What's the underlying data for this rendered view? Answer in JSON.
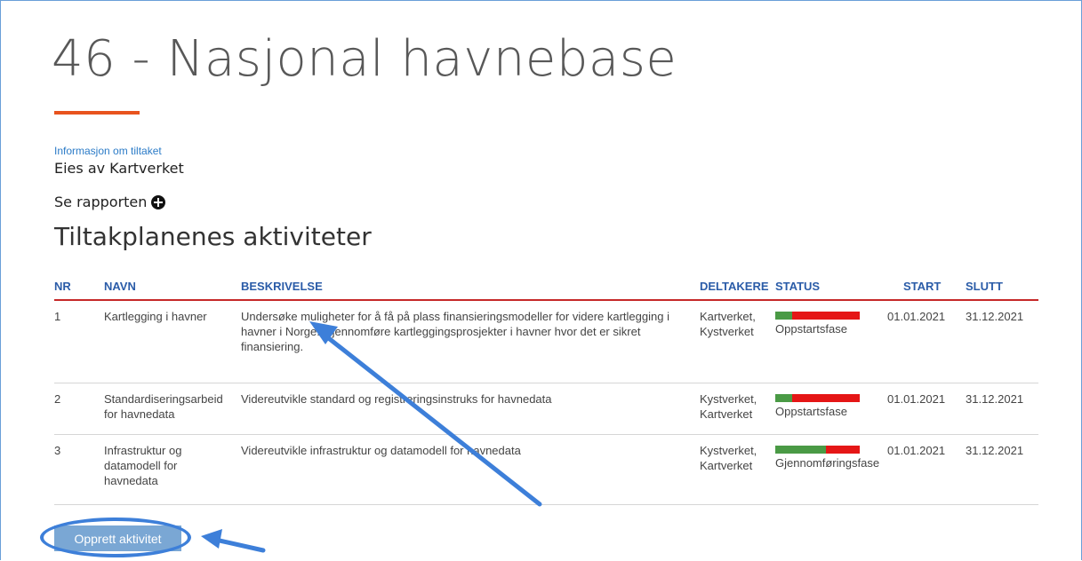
{
  "page": {
    "title": "46 - Nasjonal havnebase",
    "info_link": "Informasjon om tiltaket",
    "owner": "Eies av Kartverket",
    "see_report": "Se rapporten",
    "section_title": "Tiltakplanenes aktiviteter"
  },
  "table": {
    "headers": {
      "nr": "NR",
      "navn": "NAVN",
      "beskrivelse": "BESKRIVELSE",
      "deltakere": "DELTAKERE",
      "status": "STATUS",
      "start": "START",
      "slutt": "SLUTT"
    },
    "rows": [
      {
        "nr": "1",
        "navn": "Kartlegging i havner",
        "beskrivelse": "Undersøke muligheter for å få på plass finansieringsmodeller for videre kartlegging i havner i Norge. Gjennomføre kartleggingsprosjekter i havner hvor det er sikret finansiering.",
        "deltakere": "Kartverket, Kystverket",
        "status": "Oppstartsfase",
        "progress": 0.2,
        "start": "01.01.2021",
        "slutt": "31.12.2021"
      },
      {
        "nr": "2",
        "navn": "Standardiseringsarbeid for havnedata",
        "beskrivelse": "Videreutvikle standard og registreringsinstruks for havnedata",
        "deltakere": "Kystverket, Kartverket",
        "status": "Oppstartsfase",
        "progress": 0.2,
        "start": "01.01.2021",
        "slutt": "31.12.2021"
      },
      {
        "nr": "3",
        "navn": "Infrastruktur og datamodell for havnedata",
        "beskrivelse": "Videreutvikle infrastruktur og datamodell for havnedata",
        "deltakere": "Kystverket, Kartverket",
        "status": "Gjennomføringsfase",
        "progress": 0.6,
        "start": "01.01.2021",
        "slutt": "31.12.2021"
      }
    ]
  },
  "actions": {
    "create_button": "Opprett aktivitet"
  },
  "colors": {
    "accent_orange": "#e8531e",
    "header_blue": "#2b5ca8",
    "progress_green": "#4a9a45",
    "progress_red": "#e51616",
    "annotation_blue": "#3d7fd9"
  }
}
